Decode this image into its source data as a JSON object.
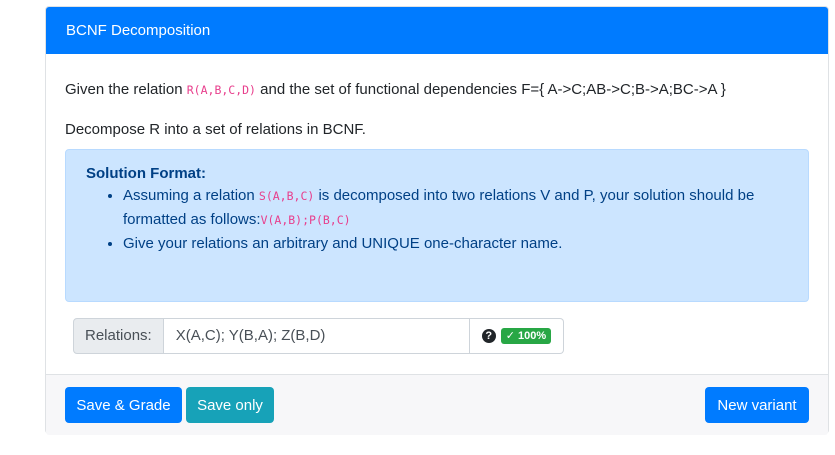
{
  "header": {
    "title": "BCNF Decomposition"
  },
  "question": {
    "intro_before": "Given the relation ",
    "relation_code": "R(A,B,C,D)",
    "intro_after": " and the set of functional dependencies F={ A->C;AB->C;B->A;BC->A }",
    "task": "Decompose R into a set of relations in BCNF."
  },
  "format": {
    "title": "Solution Format:",
    "bullet1_before": "Assuming a relation ",
    "bullet1_code": "S(A,B,C)",
    "bullet1_after": " is decomposed into two relations V and P, your solution should be formatted as follows:",
    "bullet1_example": "V(A,B);P(B,C)",
    "bullet2": "Give your relations an arbitrary and UNIQUE one-character name."
  },
  "answer": {
    "label": "Relations:",
    "value": "X(A,C); Y(B,A); Z(B,D)",
    "help": "?",
    "score": "100%",
    "score_check": "✓"
  },
  "footer": {
    "save_grade": "Save & Grade",
    "save_only": "Save only",
    "new_variant": "New variant"
  },
  "colors": {
    "primary": "#007bff",
    "info": "#17a2b8",
    "success": "#28a745",
    "alert_bg": "#cce5ff",
    "code": "#e83e8c"
  }
}
